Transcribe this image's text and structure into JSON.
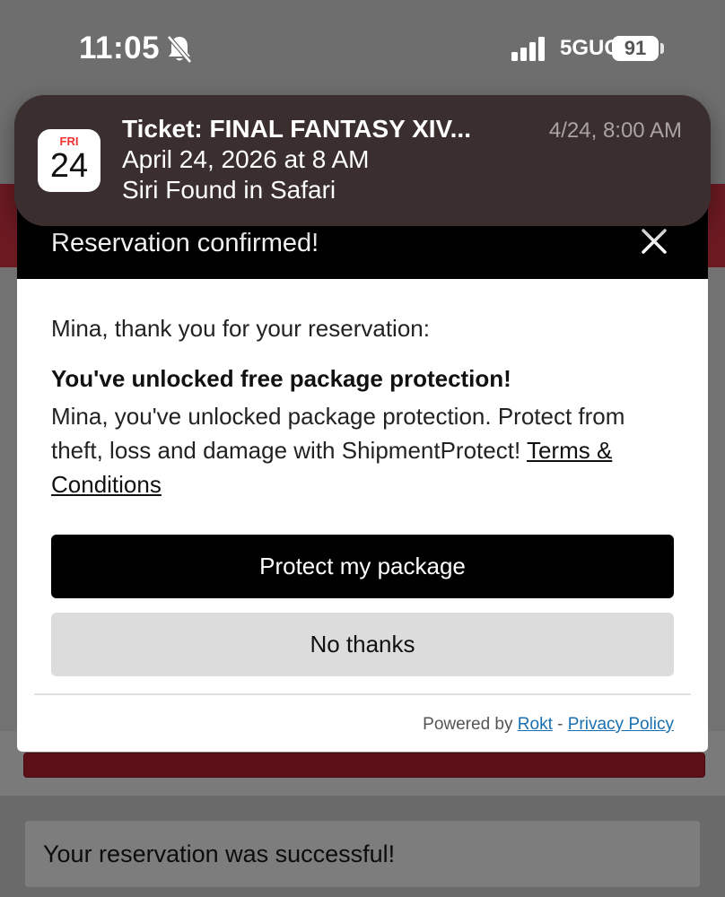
{
  "status_bar": {
    "time": "11:05",
    "network": "5GUC",
    "battery": "91"
  },
  "notification": {
    "calendar_day": "FRI",
    "calendar_date": "24",
    "title": "Ticket: FINAL FANTASY XIV...",
    "line2": "April 24, 2026 at 8 AM",
    "line3": "Siri Found in Safari",
    "timestamp": "4/24, 8:00 AM"
  },
  "modal": {
    "title": "Reservation confirmed!",
    "greeting": "Mina, thank you for your reservation:",
    "offer_title": "You've unlocked free package protection!",
    "offer_body": "Mina, you've unlocked package protection. Protect from theft, loss and damage with ShipmentProtect!",
    "terms_link": "Terms & Conditions",
    "primary_button": "Protect my package",
    "secondary_button": "No thanks",
    "footer_prefix": "Powered by",
    "footer_brand": "Rokt",
    "footer_separator": "-",
    "footer_privacy": "Privacy Policy"
  },
  "page": {
    "success_message": "Your reservation was successful!"
  },
  "colors": {
    "accent_red": "#6b1a22",
    "link_blue": "#1a6fb0",
    "modal_header": "#000000",
    "secondary_button": "#dcdcdc"
  }
}
